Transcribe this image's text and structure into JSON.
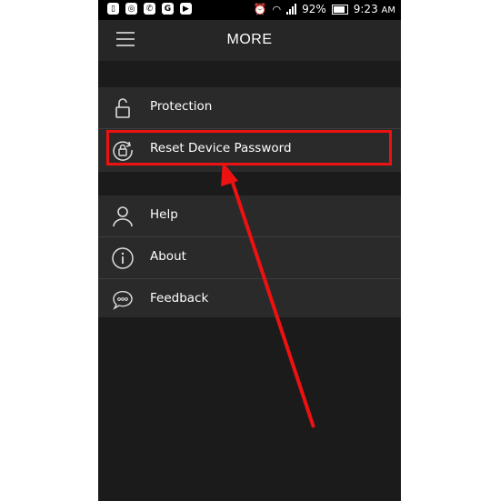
{
  "status_bar": {
    "battery": "92%",
    "time": "9:23",
    "ampm": "AM"
  },
  "app_bar": {
    "title": "MORE"
  },
  "menu": {
    "section1": [
      {
        "label": "Protection",
        "icon": "lock-icon"
      },
      {
        "label": "Reset Device Password",
        "icon": "reset-lock-icon"
      }
    ],
    "section2": [
      {
        "label": "Help",
        "icon": "person-icon"
      },
      {
        "label": "About",
        "icon": "info-icon"
      },
      {
        "label": "Feedback",
        "icon": "chat-bubble-icon"
      }
    ]
  },
  "annotation": {
    "highlight_color": "#ee1111",
    "highlighted_item": "Reset Device Password"
  }
}
